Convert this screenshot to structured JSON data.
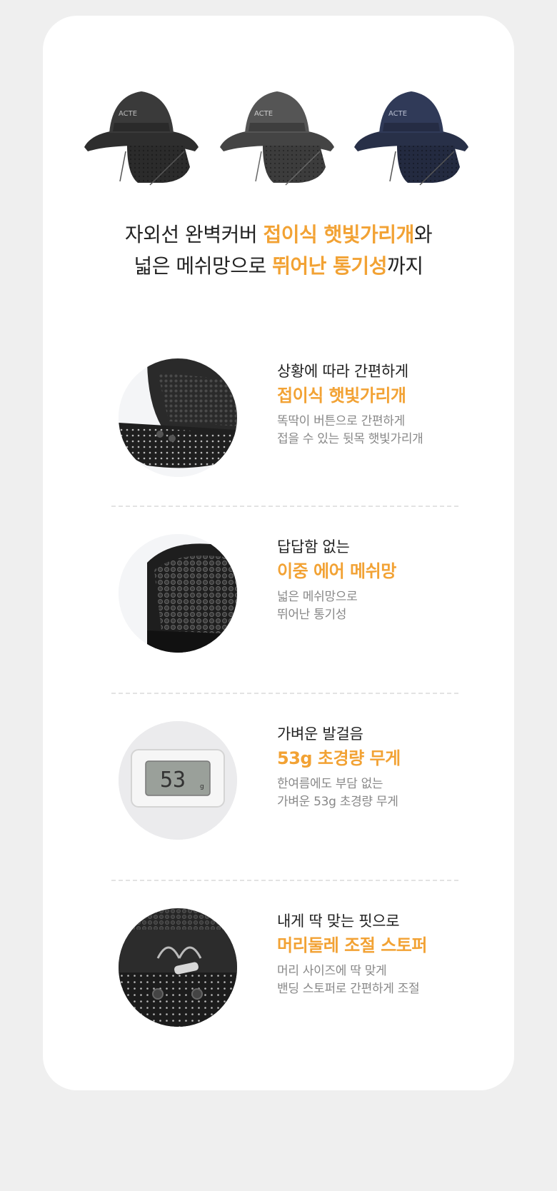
{
  "brand_logo": "ACTE",
  "headline": {
    "line1_pre": "자외선 완벽커버 ",
    "line1_hl": "접이식 햇빛가리개",
    "line1_post": "와",
    "line2_pre": "넓은 메쉬망으로 ",
    "line2_hl": "뛰어난 통기성",
    "line2_post": "까지"
  },
  "hat_colors": [
    "#3a3a3a",
    "#4e4e4e",
    "#2d3650"
  ],
  "features": [
    {
      "sub": "상황에 따라 간편하게",
      "title": "접이식 햇빛가리개",
      "desc1": "똑딱이 버튼으로 간편하게",
      "desc2": "접을 수 있는 뒷목 햇빛가리개"
    },
    {
      "sub": "답답함 없는",
      "title": "이중 에어 메쉬망",
      "desc1": "넓은 메쉬망으로",
      "desc2": "뛰어난 통기성"
    },
    {
      "sub": "가벼운 발걸음",
      "title": "53g 초경량 무게",
      "desc1": "한여름에도 부담 없는",
      "desc2": "가벼운 53g 초경량 무게",
      "scale_reading": "53",
      "scale_unit": "g"
    },
    {
      "sub": "내게 딱 맞는 핏으로",
      "title": "머리둘레 조절 스토퍼",
      "desc1": "머리 사이즈에 딱 맞게",
      "desc2": "밴딩 스토퍼로 간편하게 조절"
    }
  ],
  "colors": {
    "accent": "#f2a234",
    "card_bg": "#ffffff",
    "page_bg": "#efefef"
  }
}
